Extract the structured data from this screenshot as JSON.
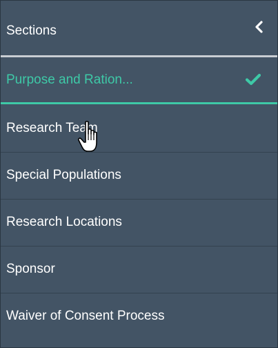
{
  "header": {
    "title": "Sections",
    "collapse_icon": "chevron-left-icon"
  },
  "sections": [
    {
      "label": "Purpose and Ration...",
      "active": true,
      "complete": true,
      "status_icon": "checkmark-icon"
    },
    {
      "label": "Research Team",
      "active": false,
      "complete": false
    },
    {
      "label": "Special Populations",
      "active": false,
      "complete": false
    },
    {
      "label": "Research Locations",
      "active": false,
      "complete": false
    },
    {
      "label": "Sponsor",
      "active": false,
      "complete": false
    },
    {
      "label": "Waiver of Consent Process",
      "active": false,
      "complete": false
    }
  ],
  "pointer": {
    "icon": "hand-pointer-icon"
  },
  "colors": {
    "panel_bg": "#435465",
    "accent": "#3ec9a7",
    "text": "#ffffff",
    "divider": "#c9ced3"
  }
}
